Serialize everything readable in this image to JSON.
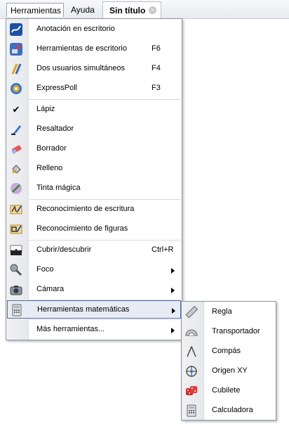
{
  "menubar": {
    "menu_herramientas": "Herramientas",
    "menu_ayuda": "Ayuda",
    "tab_title": "Sin título",
    "tab_close_glyph": "×"
  },
  "main_menu": {
    "items": [
      {
        "label": "Anotación en escritorio",
        "shortcut": "",
        "icon": "desktop-annotation-icon"
      },
      {
        "label": "Herramientas de escritorio",
        "shortcut": "F6",
        "icon": "desktop-tools-icon"
      },
      {
        "label": "Dos usuarios simultáneos",
        "shortcut": "F4",
        "icon": "dual-user-icon"
      },
      {
        "label": "ExpressPoll",
        "shortcut": "F3",
        "icon": "expresspoll-icon"
      },
      {
        "label": "Lápiz",
        "shortcut": "",
        "icon": "check-icon",
        "checked": true
      },
      {
        "label": "Resaltador",
        "shortcut": "",
        "icon": "highlighter-icon"
      },
      {
        "label": "Borrador",
        "shortcut": "",
        "icon": "eraser-icon"
      },
      {
        "label": "Relleno",
        "shortcut": "",
        "icon": "fill-icon"
      },
      {
        "label": "Tinta mágica",
        "shortcut": "",
        "icon": "magic-ink-icon"
      },
      {
        "label": "Reconocimiento de escritura",
        "shortcut": "",
        "icon": "handwriting-recognition-icon"
      },
      {
        "label": "Reconocimiento de figuras",
        "shortcut": "",
        "icon": "shape-recognition-icon"
      },
      {
        "label": "Cubrir/descubrir",
        "shortcut": "Ctrl+R",
        "icon": "reveal-icon"
      },
      {
        "label": "Foco",
        "shortcut": "",
        "icon": "spotlight-icon",
        "submenu": true
      },
      {
        "label": "Cámara",
        "shortcut": "",
        "icon": "camera-icon",
        "submenu": true
      },
      {
        "label": "Herramientas matemáticas",
        "shortcut": "",
        "icon": "math-tools-icon",
        "submenu": true,
        "highlighted": true
      },
      {
        "label": "Más herramientas...",
        "shortcut": "",
        "icon": "",
        "submenu": true
      }
    ]
  },
  "sub_menu": {
    "items": [
      {
        "label": "Regla",
        "icon": "ruler-icon"
      },
      {
        "label": "Transportador",
        "icon": "protractor-icon"
      },
      {
        "label": "Compás",
        "icon": "compass-icon"
      },
      {
        "label": "Origen XY",
        "icon": "xy-origin-icon"
      },
      {
        "label": "Cubilete",
        "icon": "dice-icon"
      },
      {
        "label": "Calculadora",
        "icon": "calculator-icon"
      }
    ]
  }
}
